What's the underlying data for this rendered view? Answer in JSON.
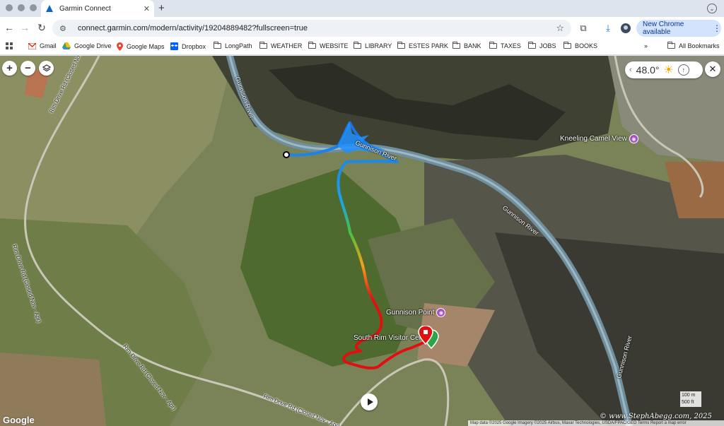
{
  "browser": {
    "tab": {
      "title": "Garmin Connect"
    },
    "url": "connect.garmin.com/modern/activity/19204889482?fullscreen=true",
    "new_chrome_label": "New Chrome available",
    "bookmarks": [
      {
        "label": "Gmail",
        "icon": "gmail-icon"
      },
      {
        "label": "Google Drive",
        "icon": "google-drive-icon"
      },
      {
        "label": "Google Maps",
        "icon": "google-maps-icon"
      },
      {
        "label": "Dropbox",
        "icon": "dropbox-icon"
      },
      {
        "label": "LongPath",
        "icon": "folder-icon"
      },
      {
        "label": "WEATHER",
        "icon": "folder-icon"
      },
      {
        "label": "WEBSITE",
        "icon": "folder-icon"
      },
      {
        "label": "LIBRARY",
        "icon": "folder-icon"
      },
      {
        "label": "ESTES PARK",
        "icon": "folder-icon"
      },
      {
        "label": "BANK",
        "icon": "folder-icon"
      },
      {
        "label": "TAXES",
        "icon": "folder-icon"
      },
      {
        "label": "JOBS",
        "icon": "folder-icon"
      },
      {
        "label": "BOOKS",
        "icon": "folder-icon"
      }
    ],
    "all_bookmarks_label": "All Bookmarks"
  },
  "map": {
    "weather": {
      "temperature": "48.0°"
    },
    "labels": {
      "gunnison_river_1": "Gunnison River",
      "gunnison_river_2": "Gunnison River",
      "gunnison_river_3": "Gunnison River",
      "gunnison_river_4": "Gunnison River",
      "kneeling_camel": "Kneeling Camel View",
      "gunnison_point": "Gunnison Point",
      "visitor_center": "South Rim Visitor Center",
      "rim_drive_1": "Rim Drive Rd (Closed Nov - Apr)",
      "rim_drive_2": "Rim Drive Rd (Closed Nov - Apr)",
      "rim_drive_3": "Rim Drive Rd (Closed Nov - Apr)",
      "rim_drive_4": "Rim Drive Rd (Closed Nov - Apr)"
    },
    "google_logo": "Google",
    "attribution": "Map data ©2025 Google Imagery ©2025 Airbus, Maxar Technologies, USDA/FPAC/GEO  Terms  Report a map error",
    "scale": {
      "metric": "100 m",
      "imperial": "500 ft"
    },
    "watermark": "© www.StephAbegg.com, 2025",
    "colors": {
      "track_start": "#1e6fe0",
      "track_mid": "#49c23c",
      "track_warm": "#f6a21c",
      "track_end": "#e01010",
      "poi": "#a64fc4"
    }
  }
}
